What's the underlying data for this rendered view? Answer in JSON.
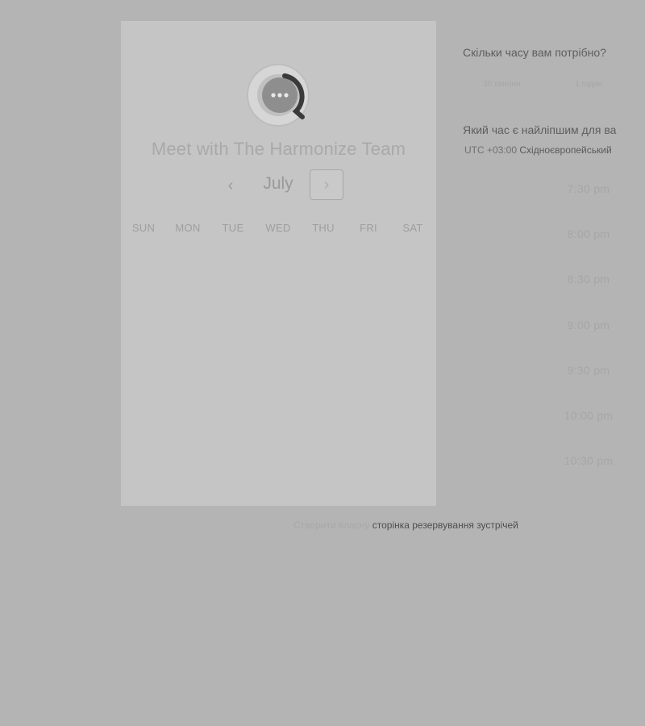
{
  "calendar": {
    "title": "Meet with The Harmonize Team",
    "month": "July",
    "prev_icon": "chevron-left-icon",
    "next_icon": "chevron-right-icon",
    "weekdays": [
      "SUN",
      "MON",
      "TUE",
      "WED",
      "THU",
      "FRI",
      "SAT"
    ]
  },
  "duration": {
    "question": "Скільки часу вам потрібно?",
    "options": [
      "30 хвилин",
      "1 годин"
    ]
  },
  "time": {
    "question": "Який час є найліпшим для ва",
    "timezone_offset": "UTC +03:00",
    "timezone_name": "Східноєвропейський",
    "slots": [
      "7:30 pm",
      "8:00 pm",
      "8:30 pm",
      "9:00 pm",
      "9:30 pm",
      "10:00 pm",
      "10:30 pm"
    ]
  },
  "footer": {
    "prefix": "Створити власну",
    "link": "сторінка резервування зустрічей"
  },
  "colors": {
    "overlay": "#b4b4b4",
    "card": "#c5c5c5",
    "logo_ring": "#d8d8d8",
    "logo_bubble": "#8e8e8e",
    "logo_arc": "#3a3a3a"
  }
}
